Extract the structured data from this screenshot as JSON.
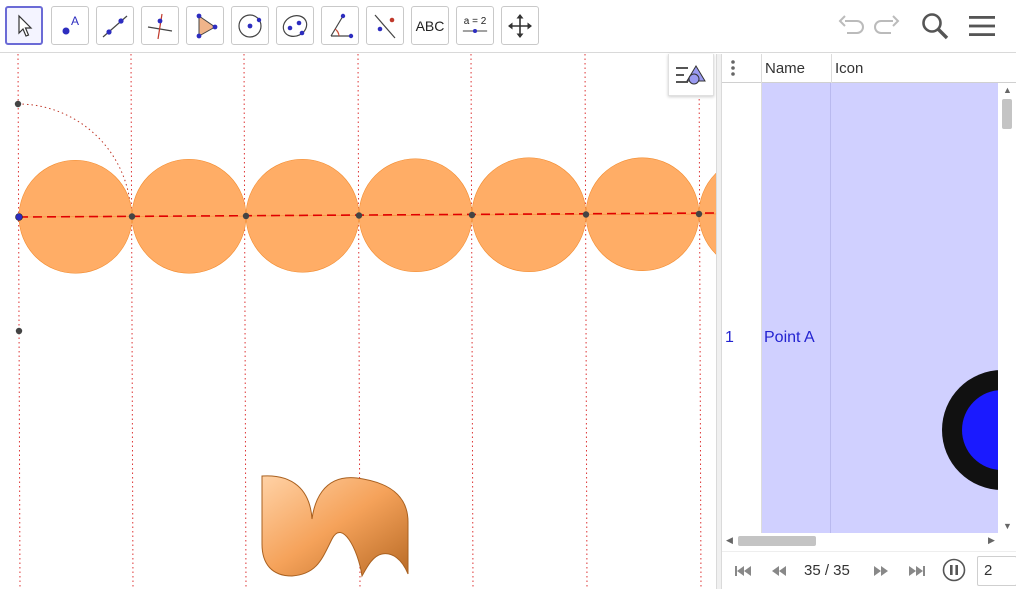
{
  "toolbar": {
    "tools": [
      {
        "name": "move",
        "icon": "arrow-cursor-icon"
      },
      {
        "name": "point",
        "icon": "point-icon",
        "label": "A"
      },
      {
        "name": "line",
        "icon": "line-icon"
      },
      {
        "name": "perpendicular",
        "icon": "perpendicular-line-icon"
      },
      {
        "name": "polygon",
        "icon": "polygon-icon"
      },
      {
        "name": "circle",
        "icon": "circle-center-point-icon"
      },
      {
        "name": "ellipse",
        "icon": "ellipse-icon"
      },
      {
        "name": "angle",
        "icon": "angle-icon"
      },
      {
        "name": "reflect",
        "icon": "reflect-line-icon"
      },
      {
        "name": "text",
        "icon": "text-icon",
        "label": "ABC"
      },
      {
        "name": "slider",
        "icon": "slider-icon",
        "label": "a = 2"
      },
      {
        "name": "move-graphics",
        "icon": "move-view-icon"
      }
    ],
    "undo_icon": "undo-icon",
    "redo_icon": "redo-icon",
    "search_icon": "search-icon",
    "menu_icon": "hamburger-menu-icon"
  },
  "graphics": {
    "fill_color": "#FFAD66",
    "line_color": "#FF0000",
    "style_bar_icon": "style-bar-toggle-icon"
  },
  "table": {
    "columns": [
      "Name",
      "Icon"
    ],
    "menu_icon": "more-vertical-icon",
    "rows": [
      {
        "index": "1",
        "name": "Point A",
        "icon_colors": [
          "#111111",
          "#1a1aff"
        ]
      }
    ],
    "selection_color": "#D0D0FF"
  },
  "playback": {
    "counter": "35 / 35",
    "speed": "2",
    "first_icon": "skip-first-icon",
    "prev_icon": "step-back-icon",
    "next_icon": "step-forward-icon",
    "last_icon": "skip-last-icon",
    "pause_icon": "pause-icon"
  }
}
